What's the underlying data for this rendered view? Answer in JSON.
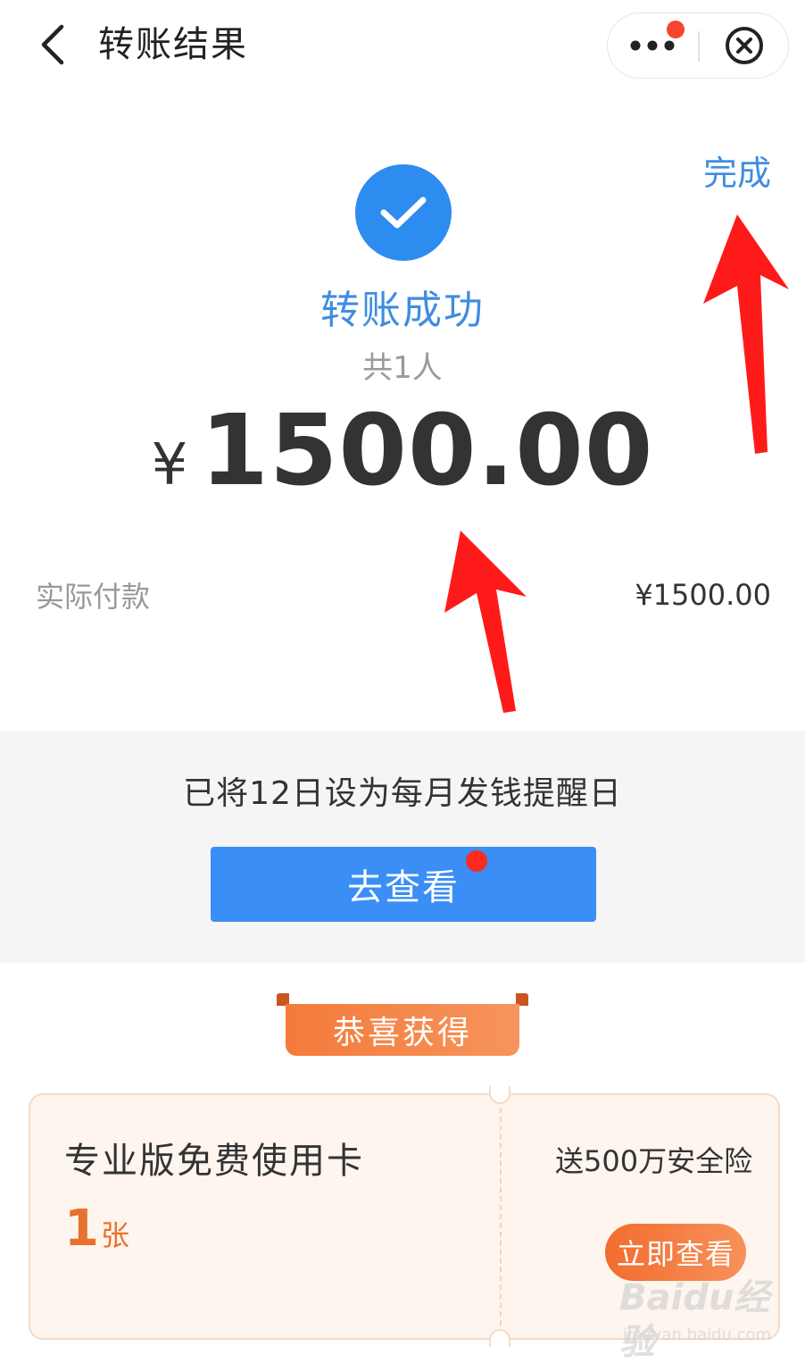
{
  "navbar": {
    "title": "转账结果",
    "back_icon": "chevron-left-icon",
    "more_icon": "more-dots-icon",
    "close_icon": "close-circle-icon"
  },
  "result": {
    "done_label": "完成",
    "status_icon": "check-circle-icon",
    "status_text": "转账成功",
    "recipient_count": "共1人",
    "currency_symbol": "¥",
    "amount": "1500.00"
  },
  "payment": {
    "label": "实际付款",
    "value": "¥1500.00"
  },
  "reminder": {
    "text": "已将12日设为每月发钱提醒日",
    "button_label": "去查看"
  },
  "reward": {
    "ribbon_label": "恭喜获得",
    "card_title": "专业版免费使用卡",
    "quantity": "1",
    "quantity_unit": "张",
    "description": "送500万安全险",
    "button_label": "立即查看"
  },
  "watermark": {
    "brand": "Baidu经验",
    "url": "jingyan.baidu.com"
  },
  "colors": {
    "accent_blue": "#3e8de0",
    "button_blue": "#3a8ef6",
    "orange": "#f36c2f",
    "annotation_red": "#ff1a1a"
  }
}
